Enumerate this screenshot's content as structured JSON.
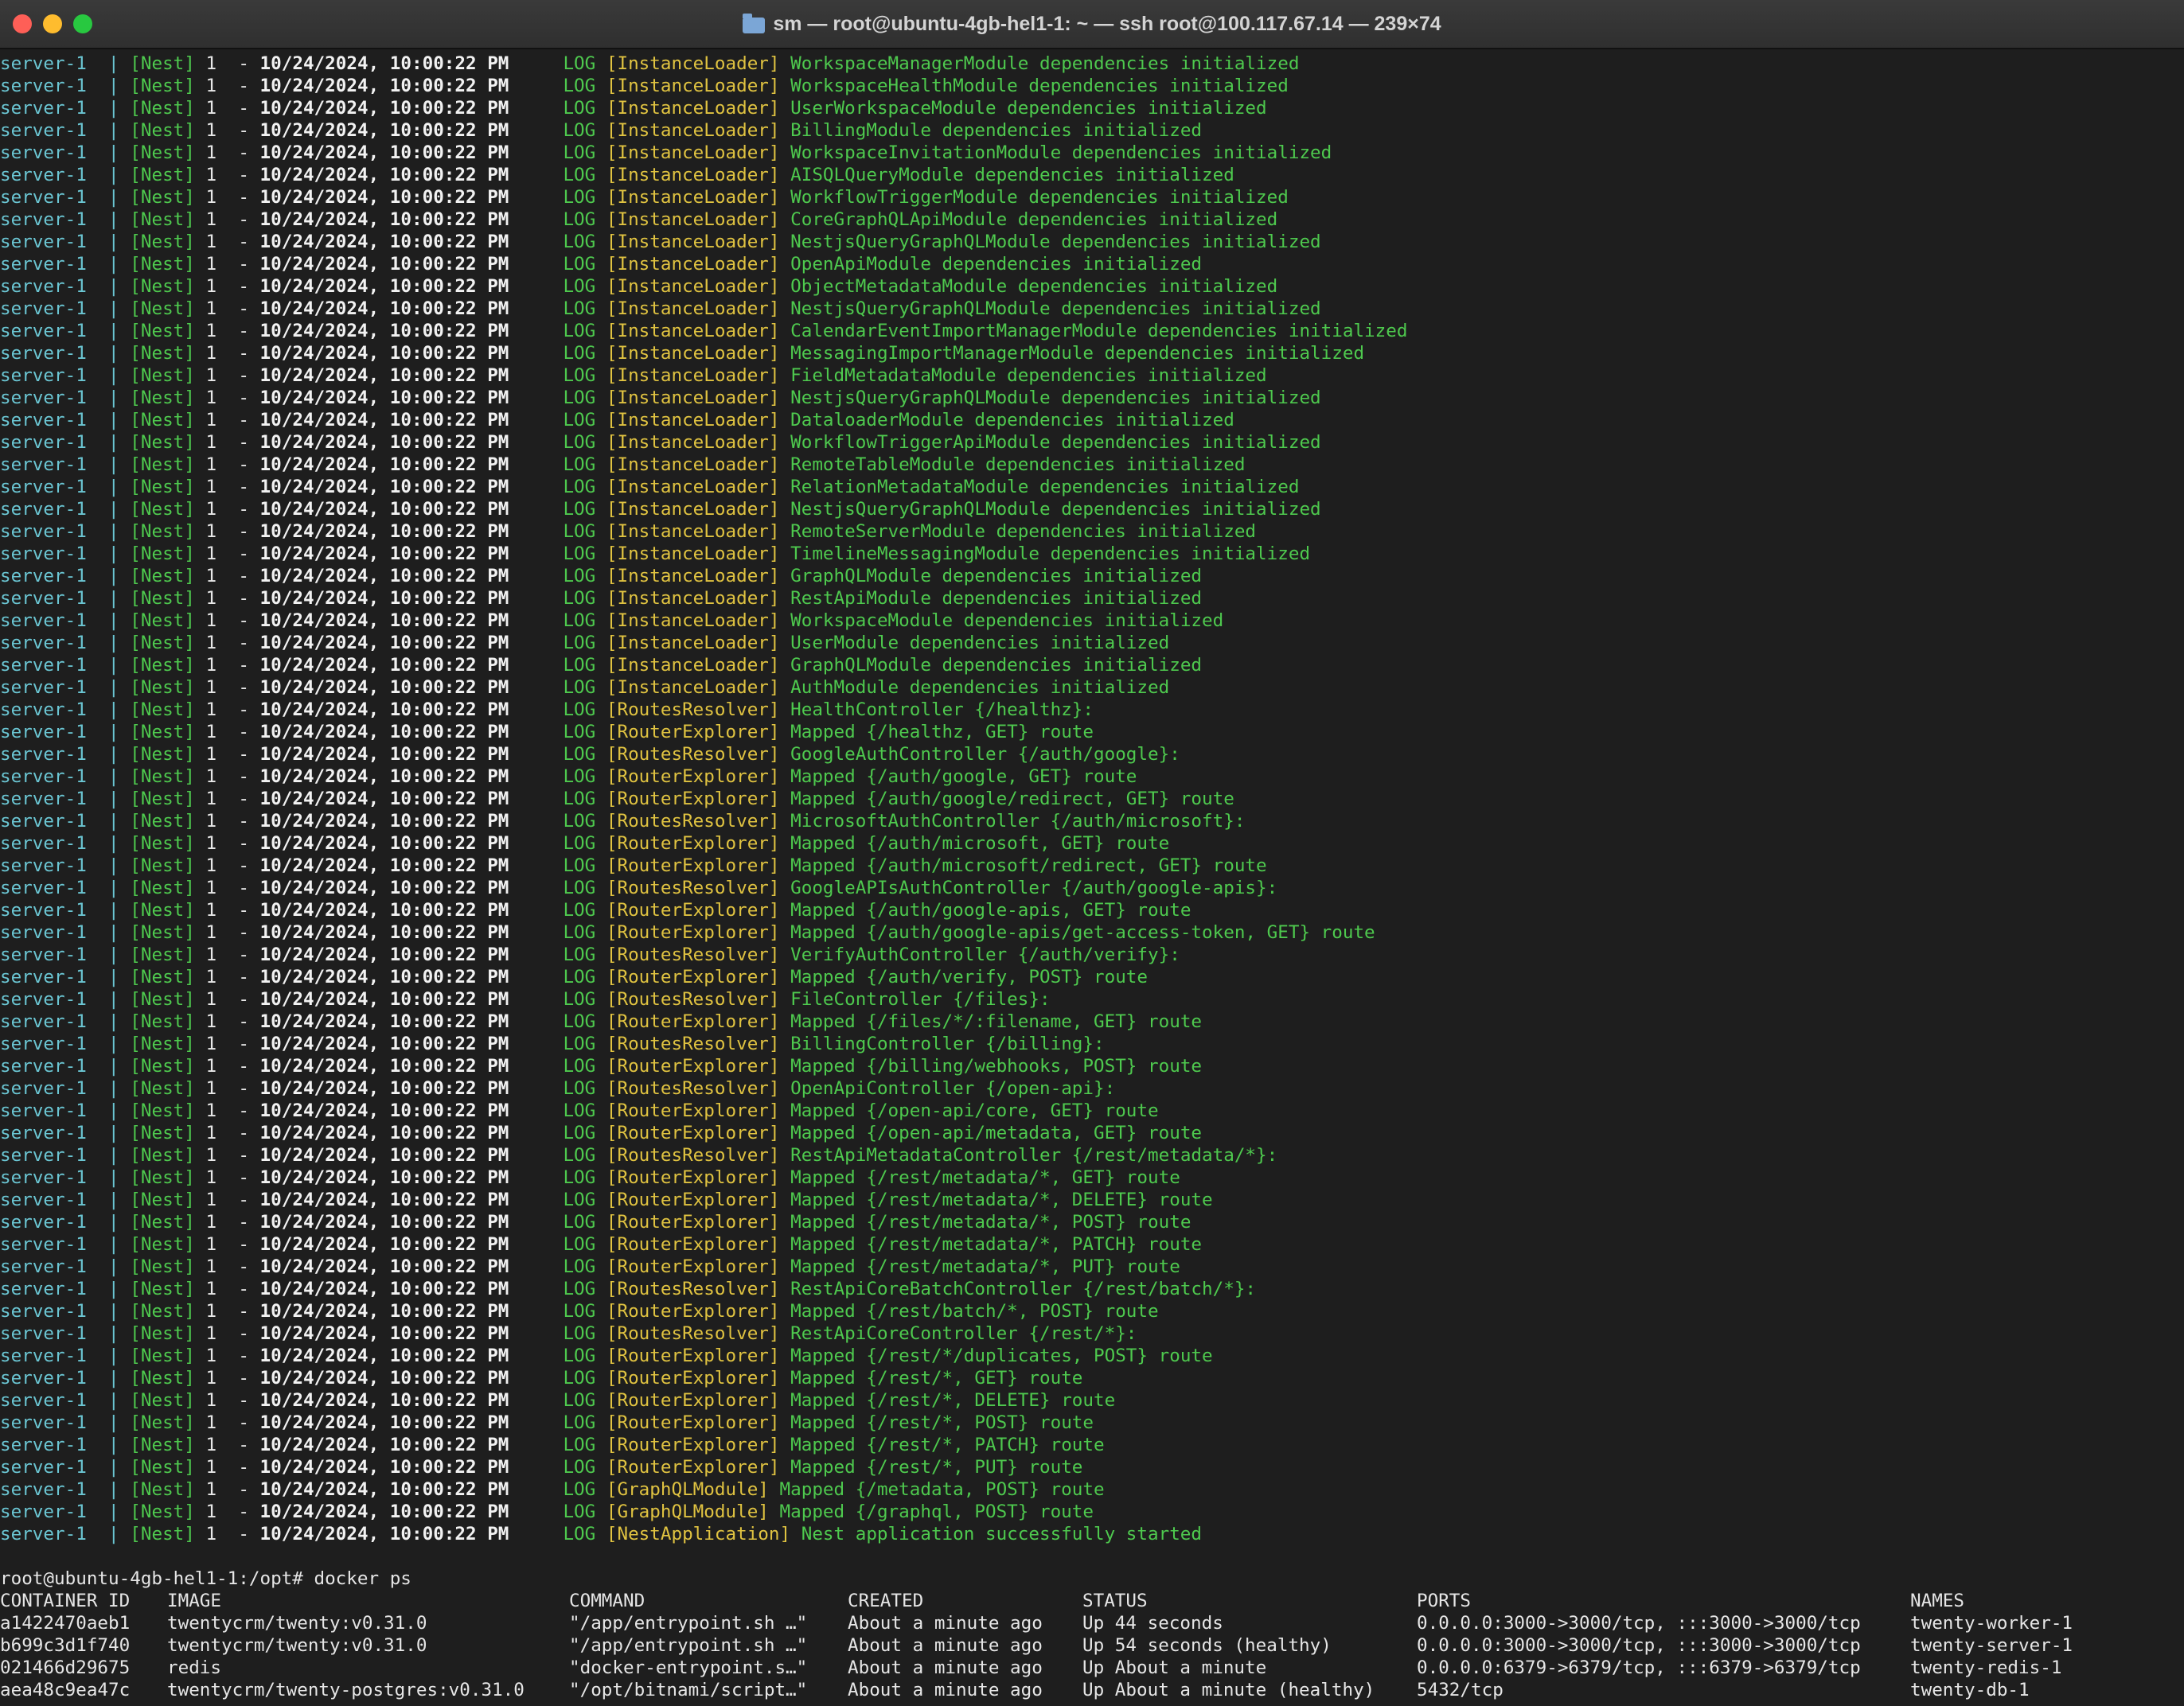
{
  "window": {
    "title": "sm — root@ubuntu-4gb-hel1-1: ~ — ssh root@100.117.67.14 — 239×74"
  },
  "log_common": {
    "service": "server-1",
    "pipe": "|",
    "nest": "[Nest]",
    "pid": "1",
    "dash": "-",
    "date": "10/24/2024, 10:00:22 PM",
    "level": "LOG"
  },
  "log_lines": [
    {
      "ctx": "[InstanceLoader]",
      "msg": "WorkspaceManagerModule dependencies initialized"
    },
    {
      "ctx": "[InstanceLoader]",
      "msg": "WorkspaceHealthModule dependencies initialized"
    },
    {
      "ctx": "[InstanceLoader]",
      "msg": "UserWorkspaceModule dependencies initialized"
    },
    {
      "ctx": "[InstanceLoader]",
      "msg": "BillingModule dependencies initialized"
    },
    {
      "ctx": "[InstanceLoader]",
      "msg": "WorkspaceInvitationModule dependencies initialized"
    },
    {
      "ctx": "[InstanceLoader]",
      "msg": "AISQLQueryModule dependencies initialized"
    },
    {
      "ctx": "[InstanceLoader]",
      "msg": "WorkflowTriggerModule dependencies initialized"
    },
    {
      "ctx": "[InstanceLoader]",
      "msg": "CoreGraphQLApiModule dependencies initialized"
    },
    {
      "ctx": "[InstanceLoader]",
      "msg": "NestjsQueryGraphQLModule dependencies initialized"
    },
    {
      "ctx": "[InstanceLoader]",
      "msg": "OpenApiModule dependencies initialized"
    },
    {
      "ctx": "[InstanceLoader]",
      "msg": "ObjectMetadataModule dependencies initialized"
    },
    {
      "ctx": "[InstanceLoader]",
      "msg": "NestjsQueryGraphQLModule dependencies initialized"
    },
    {
      "ctx": "[InstanceLoader]",
      "msg": "CalendarEventImportManagerModule dependencies initialized"
    },
    {
      "ctx": "[InstanceLoader]",
      "msg": "MessagingImportManagerModule dependencies initialized"
    },
    {
      "ctx": "[InstanceLoader]",
      "msg": "FieldMetadataModule dependencies initialized"
    },
    {
      "ctx": "[InstanceLoader]",
      "msg": "NestjsQueryGraphQLModule dependencies initialized"
    },
    {
      "ctx": "[InstanceLoader]",
      "msg": "DataloaderModule dependencies initialized"
    },
    {
      "ctx": "[InstanceLoader]",
      "msg": "WorkflowTriggerApiModule dependencies initialized"
    },
    {
      "ctx": "[InstanceLoader]",
      "msg": "RemoteTableModule dependencies initialized"
    },
    {
      "ctx": "[InstanceLoader]",
      "msg": "RelationMetadataModule dependencies initialized"
    },
    {
      "ctx": "[InstanceLoader]",
      "msg": "NestjsQueryGraphQLModule dependencies initialized"
    },
    {
      "ctx": "[InstanceLoader]",
      "msg": "RemoteServerModule dependencies initialized"
    },
    {
      "ctx": "[InstanceLoader]",
      "msg": "TimelineMessagingModule dependencies initialized"
    },
    {
      "ctx": "[InstanceLoader]",
      "msg": "GraphQLModule dependencies initialized"
    },
    {
      "ctx": "[InstanceLoader]",
      "msg": "RestApiModule dependencies initialized"
    },
    {
      "ctx": "[InstanceLoader]",
      "msg": "WorkspaceModule dependencies initialized"
    },
    {
      "ctx": "[InstanceLoader]",
      "msg": "UserModule dependencies initialized"
    },
    {
      "ctx": "[InstanceLoader]",
      "msg": "GraphQLModule dependencies initialized"
    },
    {
      "ctx": "[InstanceLoader]",
      "msg": "AuthModule dependencies initialized"
    },
    {
      "ctx": "[RoutesResolver]",
      "msg": "HealthController {/healthz}:"
    },
    {
      "ctx": "[RouterExplorer]",
      "msg": "Mapped {/healthz, GET} route"
    },
    {
      "ctx": "[RoutesResolver]",
      "msg": "GoogleAuthController {/auth/google}:"
    },
    {
      "ctx": "[RouterExplorer]",
      "msg": "Mapped {/auth/google, GET} route"
    },
    {
      "ctx": "[RouterExplorer]",
      "msg": "Mapped {/auth/google/redirect, GET} route"
    },
    {
      "ctx": "[RoutesResolver]",
      "msg": "MicrosoftAuthController {/auth/microsoft}:"
    },
    {
      "ctx": "[RouterExplorer]",
      "msg": "Mapped {/auth/microsoft, GET} route"
    },
    {
      "ctx": "[RouterExplorer]",
      "msg": "Mapped {/auth/microsoft/redirect, GET} route"
    },
    {
      "ctx": "[RoutesResolver]",
      "msg": "GoogleAPIsAuthController {/auth/google-apis}:"
    },
    {
      "ctx": "[RouterExplorer]",
      "msg": "Mapped {/auth/google-apis, GET} route"
    },
    {
      "ctx": "[RouterExplorer]",
      "msg": "Mapped {/auth/google-apis/get-access-token, GET} route"
    },
    {
      "ctx": "[RoutesResolver]",
      "msg": "VerifyAuthController {/auth/verify}:"
    },
    {
      "ctx": "[RouterExplorer]",
      "msg": "Mapped {/auth/verify, POST} route"
    },
    {
      "ctx": "[RoutesResolver]",
      "msg": "FileController {/files}:"
    },
    {
      "ctx": "[RouterExplorer]",
      "msg": "Mapped {/files/*/:filename, GET} route"
    },
    {
      "ctx": "[RoutesResolver]",
      "msg": "BillingController {/billing}:"
    },
    {
      "ctx": "[RouterExplorer]",
      "msg": "Mapped {/billing/webhooks, POST} route"
    },
    {
      "ctx": "[RoutesResolver]",
      "msg": "OpenApiController {/open-api}:"
    },
    {
      "ctx": "[RouterExplorer]",
      "msg": "Mapped {/open-api/core, GET} route"
    },
    {
      "ctx": "[RouterExplorer]",
      "msg": "Mapped {/open-api/metadata, GET} route"
    },
    {
      "ctx": "[RoutesResolver]",
      "msg": "RestApiMetadataController {/rest/metadata/*}:"
    },
    {
      "ctx": "[RouterExplorer]",
      "msg": "Mapped {/rest/metadata/*, GET} route"
    },
    {
      "ctx": "[RouterExplorer]",
      "msg": "Mapped {/rest/metadata/*, DELETE} route"
    },
    {
      "ctx": "[RouterExplorer]",
      "msg": "Mapped {/rest/metadata/*, POST} route"
    },
    {
      "ctx": "[RouterExplorer]",
      "msg": "Mapped {/rest/metadata/*, PATCH} route"
    },
    {
      "ctx": "[RouterExplorer]",
      "msg": "Mapped {/rest/metadata/*, PUT} route"
    },
    {
      "ctx": "[RoutesResolver]",
      "msg": "RestApiCoreBatchController {/rest/batch/*}:"
    },
    {
      "ctx": "[RouterExplorer]",
      "msg": "Mapped {/rest/batch/*, POST} route"
    },
    {
      "ctx": "[RoutesResolver]",
      "msg": "RestApiCoreController {/rest/*}:"
    },
    {
      "ctx": "[RouterExplorer]",
      "msg": "Mapped {/rest/*/duplicates, POST} route"
    },
    {
      "ctx": "[RouterExplorer]",
      "msg": "Mapped {/rest/*, GET} route"
    },
    {
      "ctx": "[RouterExplorer]",
      "msg": "Mapped {/rest/*, DELETE} route"
    },
    {
      "ctx": "[RouterExplorer]",
      "msg": "Mapped {/rest/*, POST} route"
    },
    {
      "ctx": "[RouterExplorer]",
      "msg": "Mapped {/rest/*, PATCH} route"
    },
    {
      "ctx": "[RouterExplorer]",
      "msg": "Mapped {/rest/*, PUT} route"
    },
    {
      "ctx": "[GraphQLModule]",
      "msg": "Mapped {/metadata, POST} route"
    },
    {
      "ctx": "[GraphQLModule]",
      "msg": "Mapped {/graphql, POST} route"
    },
    {
      "ctx": "[NestApplication]",
      "msg": "Nest application successfully started"
    }
  ],
  "prompt": {
    "text": "root@ubuntu-4gb-hel1-1:/opt# docker ps"
  },
  "docker_table": {
    "headers": [
      "CONTAINER ID",
      "IMAGE",
      "COMMAND",
      "CREATED",
      "STATUS",
      "PORTS",
      "NAMES"
    ],
    "rows": [
      [
        "a1422470aeb1",
        "twentycrm/twenty:v0.31.0",
        "\"/app/entrypoint.sh …\"",
        "About a minute ago",
        "Up 44 seconds",
        "0.0.0.0:3000->3000/tcp, :::3000->3000/tcp",
        "twenty-worker-1"
      ],
      [
        "b699c3d1f740",
        "twentycrm/twenty:v0.31.0",
        "\"/app/entrypoint.sh …\"",
        "About a minute ago",
        "Up 54 seconds (healthy)",
        "0.0.0.0:3000->3000/tcp, :::3000->3000/tcp",
        "twenty-server-1"
      ],
      [
        "021466d29675",
        "redis",
        "\"docker-entrypoint.s…\"",
        "About a minute ago",
        "Up About a minute",
        "0.0.0.0:6379->6379/tcp, :::6379->6379/tcp",
        "twenty-redis-1"
      ],
      [
        "aea48c9ea47c",
        "twentycrm/twenty-postgres:v0.31.0",
        "\"/opt/bitnami/script…\"",
        "About a minute ago",
        "Up About a minute (healthy)",
        "5432/tcp",
        "twenty-db-1"
      ]
    ]
  },
  "colors": {
    "background": "#1e1e1e",
    "service": "#6bc6d3",
    "nest_green": "#4ec94e",
    "context_yellow": "#e0c341",
    "text": "#e6e6e6"
  }
}
